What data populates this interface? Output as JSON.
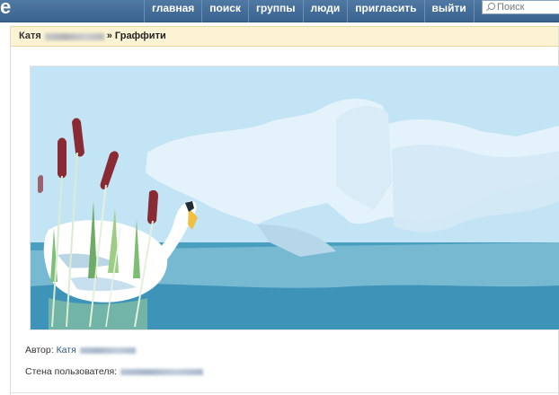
{
  "header": {
    "logo_fragment": "e",
    "nav": [
      {
        "label": "главная"
      },
      {
        "label": "поиск"
      },
      {
        "label": "группы"
      },
      {
        "label": "люди"
      },
      {
        "label": "пригласить"
      },
      {
        "label": "выйти"
      }
    ],
    "search": {
      "placeholder": "Поиск"
    }
  },
  "breadcrumb": {
    "user_name": "Катя",
    "separator": "»",
    "section": "Граффити"
  },
  "graffiti": {
    "icon": "swan-graffiti-image",
    "colors": {
      "sky": "#c3e4f4",
      "water": "#4a9fc0",
      "swan": "#ffffff",
      "reed": "#8a2a34"
    }
  },
  "meta": {
    "author_label": "Автор:",
    "author_name": "Катя",
    "wall_label": "Стена пользователя:"
  }
}
